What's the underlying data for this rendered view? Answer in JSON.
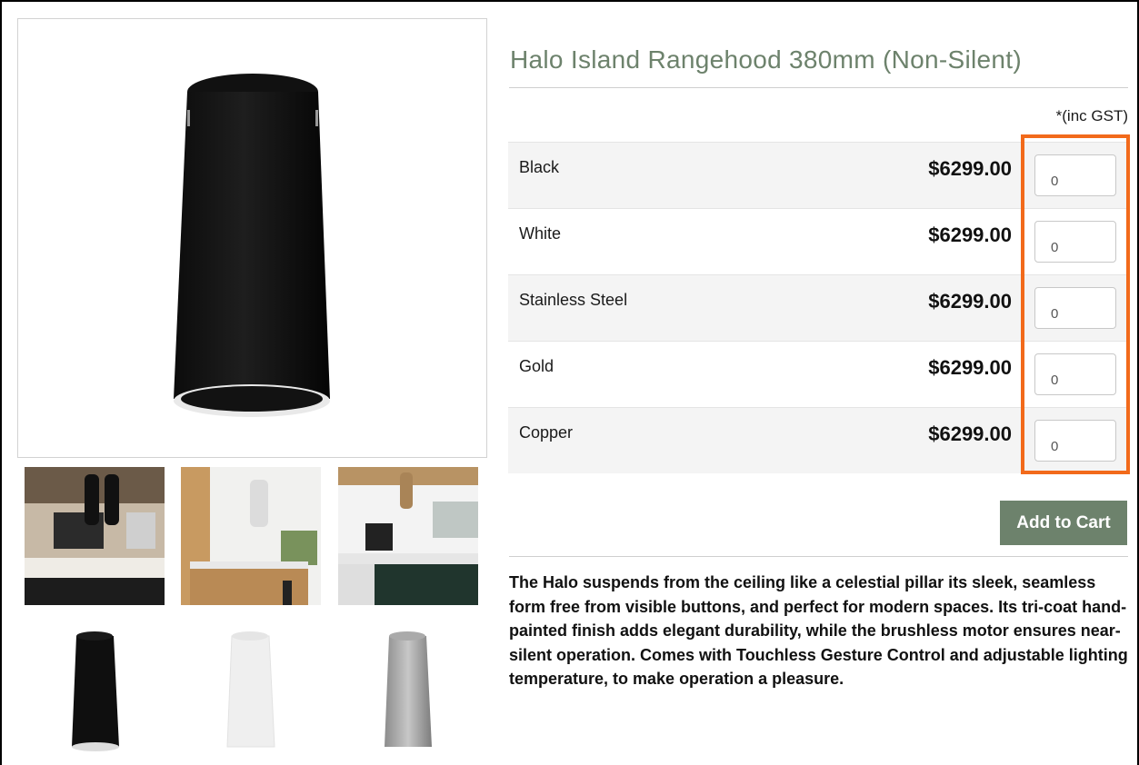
{
  "product": {
    "title": "Halo Island Rangehood 380mm (Non-Silent)",
    "gst_note": "*(inc GST)",
    "variants": [
      {
        "name": "Black",
        "price": "$6299.00",
        "qty": "0"
      },
      {
        "name": "White",
        "price": "$6299.00",
        "qty": "0"
      },
      {
        "name": "Stainless Steel",
        "price": "$6299.00",
        "qty": "0"
      },
      {
        "name": "Gold",
        "price": "$6299.00",
        "qty": "0"
      },
      {
        "name": "Copper",
        "price": "$6299.00",
        "qty": "0"
      }
    ],
    "add_to_cart_label": "Add to Cart",
    "description": "The Halo suspends from the ceiling like a celestial pillar its sleek, seamless form free from visible buttons, and perfect for modern spaces. Its tri-coat hand-painted finish adds elegant durability, while the brushless motor ensures near-silent operation. Comes with Touchless Gesture Control and adjustable lighting temperature, to make operation a pleasure."
  },
  "colors": {
    "accent": "#6d826c",
    "highlight": "#f26a1b"
  },
  "gallery": {
    "main_image": "rangehood-black-product-image",
    "thumbnails": [
      "kitchen-black-rangehoods",
      "kitchen-white-rangehood",
      "kitchen-gold-rangehood",
      "black-rangehood",
      "white-rangehood",
      "stainless-rangehood"
    ]
  }
}
